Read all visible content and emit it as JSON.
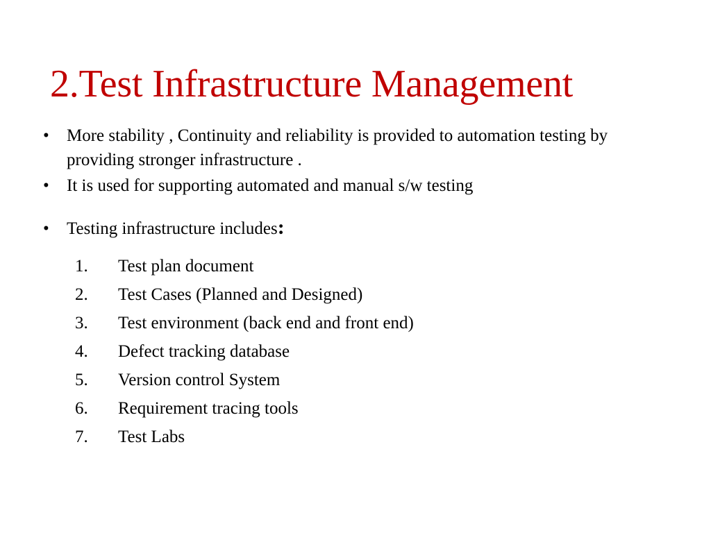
{
  "slide": {
    "title": "2.Test Infrastructure Management",
    "title_color": "#c00000",
    "body_color": "#000000",
    "background_color": "#ffffff",
    "bullets": [
      {
        "marker": "•",
        "text": "More stability , Continuity and reliability is provided to automation testing by providing stronger infrastructure ."
      },
      {
        "marker": "•",
        "text": "It is used for supporting automated and manual s/w testing"
      },
      {
        "marker": "•",
        "text": "Testing infrastructure includes",
        "trailing_colon": ":"
      }
    ],
    "numbered_list": [
      {
        "number": "1.",
        "text": "Test plan document"
      },
      {
        "number": "2.",
        "text": "Test Cases (Planned and Designed)"
      },
      {
        "number": "3.",
        "text": "Test environment (back end and front end)"
      },
      {
        "number": "4.",
        "text": "Defect tracking database"
      },
      {
        "number": "5.",
        "text": "Version control System"
      },
      {
        "number": "6.",
        "text": "Requirement tracing tools"
      },
      {
        "number": "7.",
        "text": "Test Labs"
      }
    ]
  }
}
